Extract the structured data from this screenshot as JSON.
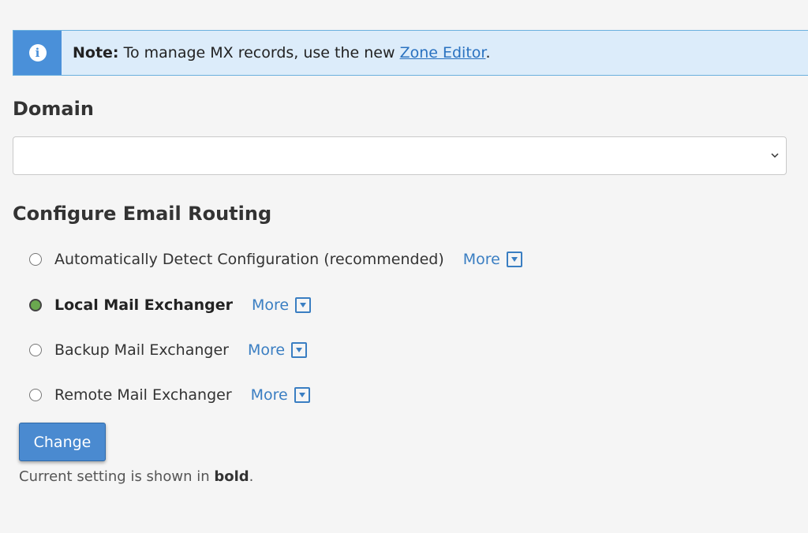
{
  "note": {
    "icon": "info-icon",
    "label": "Note:",
    "text": "To manage MX records, use the new",
    "link": "Zone Editor",
    "suffix": "."
  },
  "domain": {
    "heading": "Domain",
    "selected_value": ""
  },
  "routing": {
    "heading": "Configure Email Routing",
    "options": [
      {
        "label": "Automatically Detect Configuration (recommended)",
        "more": "More",
        "checked": false
      },
      {
        "label": "Local Mail Exchanger",
        "more": "More",
        "checked": true
      },
      {
        "label": "Backup Mail Exchanger",
        "more": "More",
        "checked": false
      },
      {
        "label": "Remote Mail Exchanger",
        "more": "More",
        "checked": false
      }
    ],
    "button": "Change",
    "footnote_prefix": "Current setting is shown in",
    "footnote_bold": "bold",
    "footnote_suffix": "."
  },
  "colors": {
    "accent": "#4a90d9",
    "note_bg": "#dcecfa",
    "link": "#3a7ec2",
    "button_bg": "#4a8ad0",
    "checked_radio": "#6aa84f"
  }
}
